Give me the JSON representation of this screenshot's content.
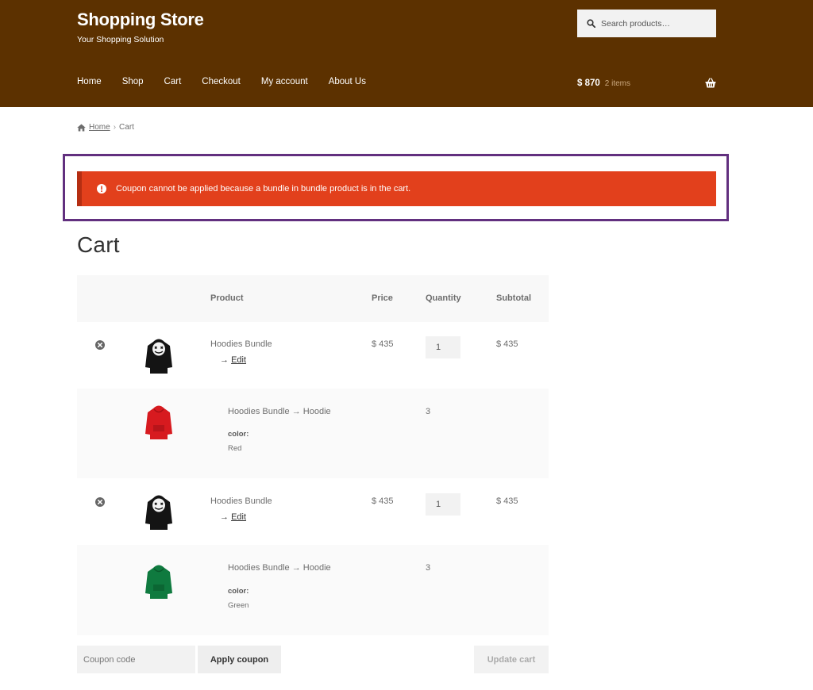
{
  "site": {
    "title": "Shopping Store",
    "tagline": "Your Shopping Solution",
    "search_placeholder": "Search products…"
  },
  "nav": [
    "Home",
    "Shop",
    "Cart",
    "Checkout",
    "My account",
    "About Us"
  ],
  "header_cart": {
    "total": "$ 870",
    "count": "2 items"
  },
  "breadcrumb": {
    "home": "Home",
    "separator": "›",
    "current": "Cart"
  },
  "notice": {
    "message": "Coupon cannot be applied because a bundle in bundle product is in the cart."
  },
  "page_title": "Cart",
  "table": {
    "headers": {
      "product": "Product",
      "price": "Price",
      "quantity": "Quantity",
      "subtotal": "Subtotal"
    },
    "rows": [
      {
        "type": "bundle",
        "name": "Hoodies Bundle",
        "edit_prefix": "→ ",
        "edit_label": "Edit",
        "price": "$ 435",
        "qty": "1",
        "subtotal": "$ 435",
        "thumb": "hoodie-black-icon"
      },
      {
        "type": "item",
        "name": "Hoodies Bundle → Hoodie",
        "qty": "3",
        "meta_label": "color:",
        "meta_value": "Red",
        "thumb": "hoodie-red-icon",
        "color": "#d71a1f"
      },
      {
        "type": "bundle",
        "name": "Hoodies Bundle",
        "edit_prefix": "→ ",
        "edit_label": "Edit",
        "price": "$ 435",
        "qty": "1",
        "subtotal": "$ 435",
        "thumb": "hoodie-black-icon"
      },
      {
        "type": "item",
        "name": "Hoodies Bundle → Hoodie",
        "qty": "3",
        "meta_label": "color:",
        "meta_value": "Green",
        "thumb": "hoodie-green-icon",
        "color": "#0f7a3f"
      }
    ]
  },
  "actions": {
    "coupon_placeholder": "Coupon code",
    "apply_label": "Apply coupon",
    "update_label": "Update cart"
  },
  "colors": {
    "header_bg": "#5c3100",
    "notice_bg": "#e2401c",
    "highlight_border": "#62307f"
  }
}
